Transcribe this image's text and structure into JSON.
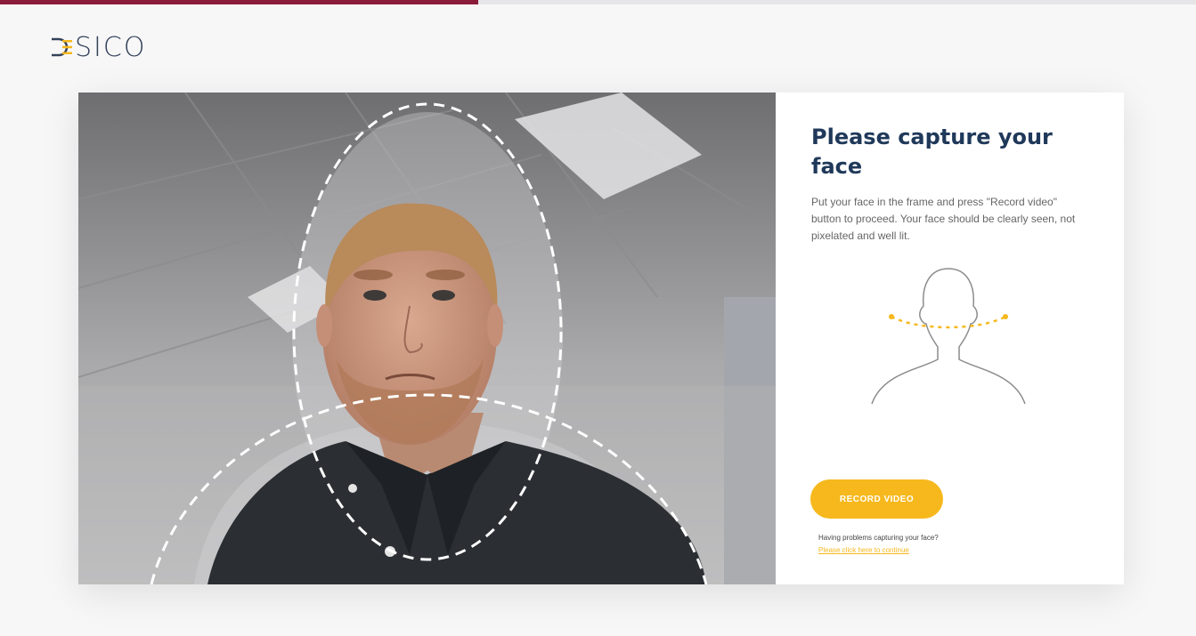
{
  "progress": {
    "fraction": 0.4
  },
  "brand": {
    "logo_text": "SICO",
    "accent_color": "#f6b81c",
    "progress_color": "#8a1c3a",
    "title_color": "#20395a"
  },
  "camera": {
    "overlay_icon": "face-guide-ellipse-icon"
  },
  "panel": {
    "title": "Please capture your face",
    "description": "Put your face in the frame and press \"Record video\" button to proceed. Your face should be clearly seen, not pixelated and well lit.",
    "illustration_icon": "head-rotate-guide-icon",
    "record_button_label": "Record video",
    "help_text": "Having problems capturing your face?",
    "help_link": "Please click here to continue"
  }
}
